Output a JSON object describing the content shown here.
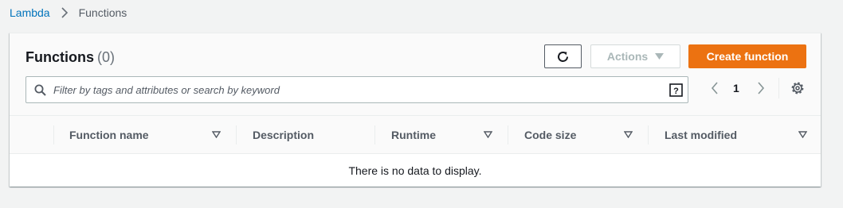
{
  "breadcrumb": {
    "root": "Lambda",
    "current": "Functions"
  },
  "header": {
    "title": "Functions",
    "count": "(0)",
    "actions_label": "Actions",
    "create_label": "Create function"
  },
  "search": {
    "placeholder": "Filter by tags and attributes or search by keyword"
  },
  "pagination": {
    "current_page": "1"
  },
  "table": {
    "columns": [
      "Function name",
      "Description",
      "Runtime",
      "Code size",
      "Last modified"
    ],
    "empty_message": "There is no data to display."
  },
  "colors": {
    "primary_button": "#ec7211",
    "link": "#0073bb"
  }
}
